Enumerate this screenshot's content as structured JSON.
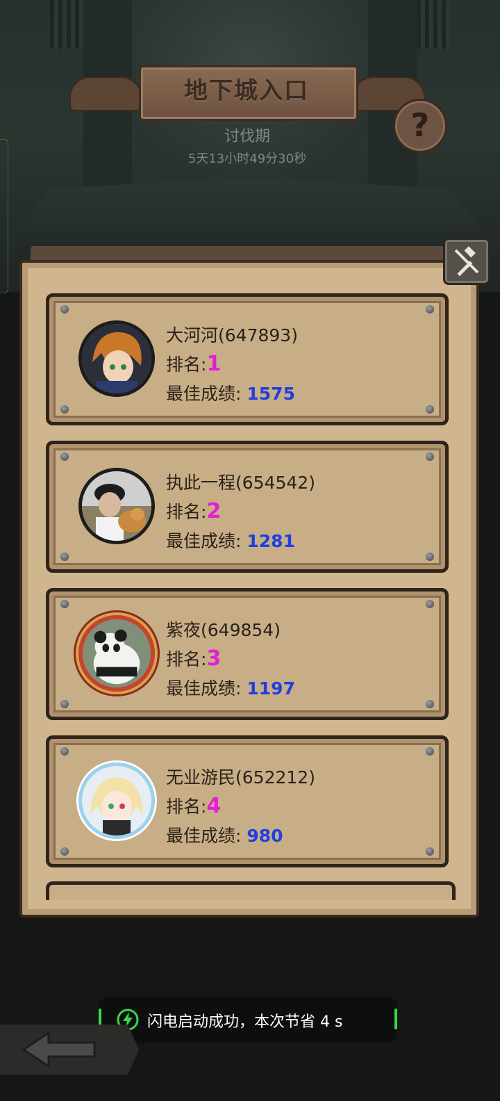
{
  "header": {
    "title": "地下城入口",
    "subtitle": "讨伐期",
    "countdown": "5天13小时49分30秒",
    "help_icon": "question-mark-icon",
    "tool_icon": "hammer-sword-icon"
  },
  "ranking": {
    "rank_label": "排名:",
    "score_label": "最佳成绩:",
    "entries": [
      {
        "name": "大河河(647893)",
        "rank": "1",
        "score": "1575",
        "avatar": "anime-boy-avatar"
      },
      {
        "name": "执此一程(654542)",
        "rank": "2",
        "score": "1281",
        "avatar": "photo-man-dog-avatar"
      },
      {
        "name": "紫夜(649854)",
        "rank": "3",
        "score": "1197",
        "avatar": "panda-avatar"
      },
      {
        "name": "无业游民(652212)",
        "rank": "4",
        "score": "980",
        "avatar": "anime-girl-avatar"
      }
    ]
  },
  "toast": {
    "text": "闪电启动成功，本次节省 4 s",
    "icon": "lightning-icon"
  },
  "navigation": {
    "back_icon": "back-arrow-icon"
  },
  "colors": {
    "rank": "#e21fd5",
    "score": "#1f3fe0",
    "parchment": "#c8ae86",
    "toast_accent": "#39d84b"
  }
}
